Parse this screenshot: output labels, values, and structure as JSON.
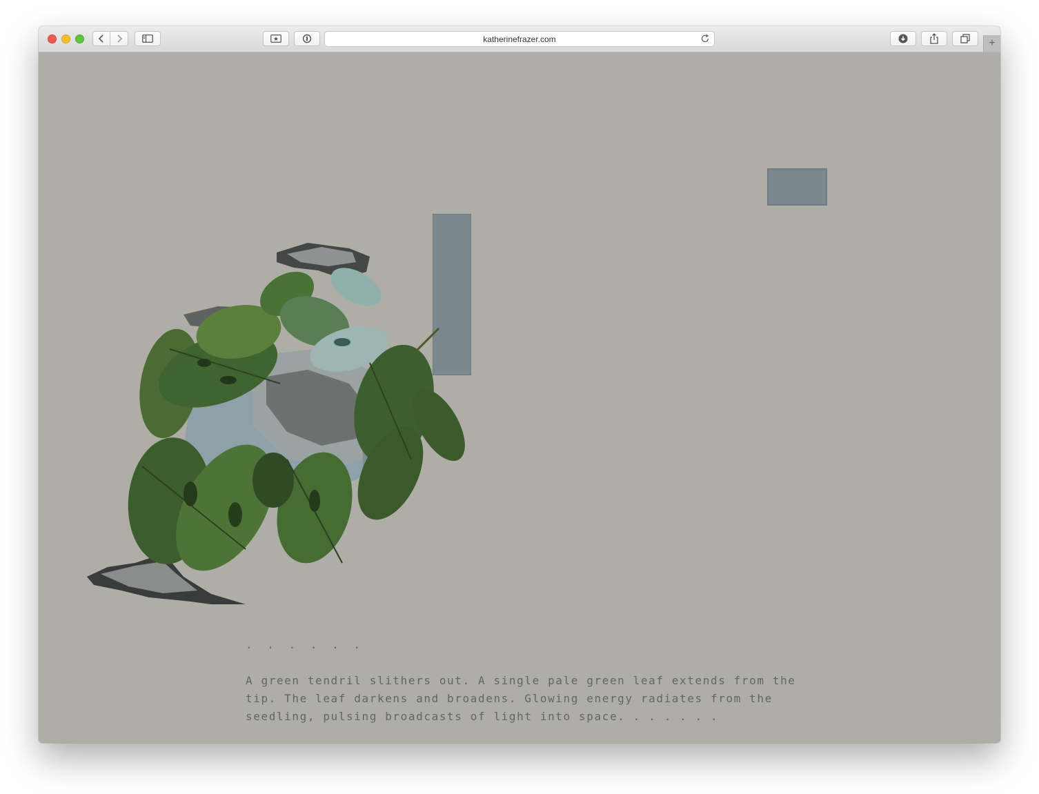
{
  "browser": {
    "url": "katherinefrazer.com",
    "buttons": {
      "back": "chevron-left-icon",
      "forward": "chevron-right-icon",
      "sidebar": "sidebar-icon",
      "bookmark": "star-icon",
      "password": "key-icon",
      "reload": "reload-icon",
      "download": "download-icon",
      "share": "share-icon",
      "tabs": "tabs-icon",
      "new_tab": "+"
    }
  },
  "page": {
    "background_color": "#aeaea7",
    "accent_rect_color": "#7b898e",
    "ellipsis": ". . . . . .",
    "paragraph": "A green tendril slithers out. A single pale green leaf extends from the tip. The leaf darkens and broadens. Glowing energy radiates from the seedling, pulsing broadcasts of light into space. . . . . . ."
  }
}
